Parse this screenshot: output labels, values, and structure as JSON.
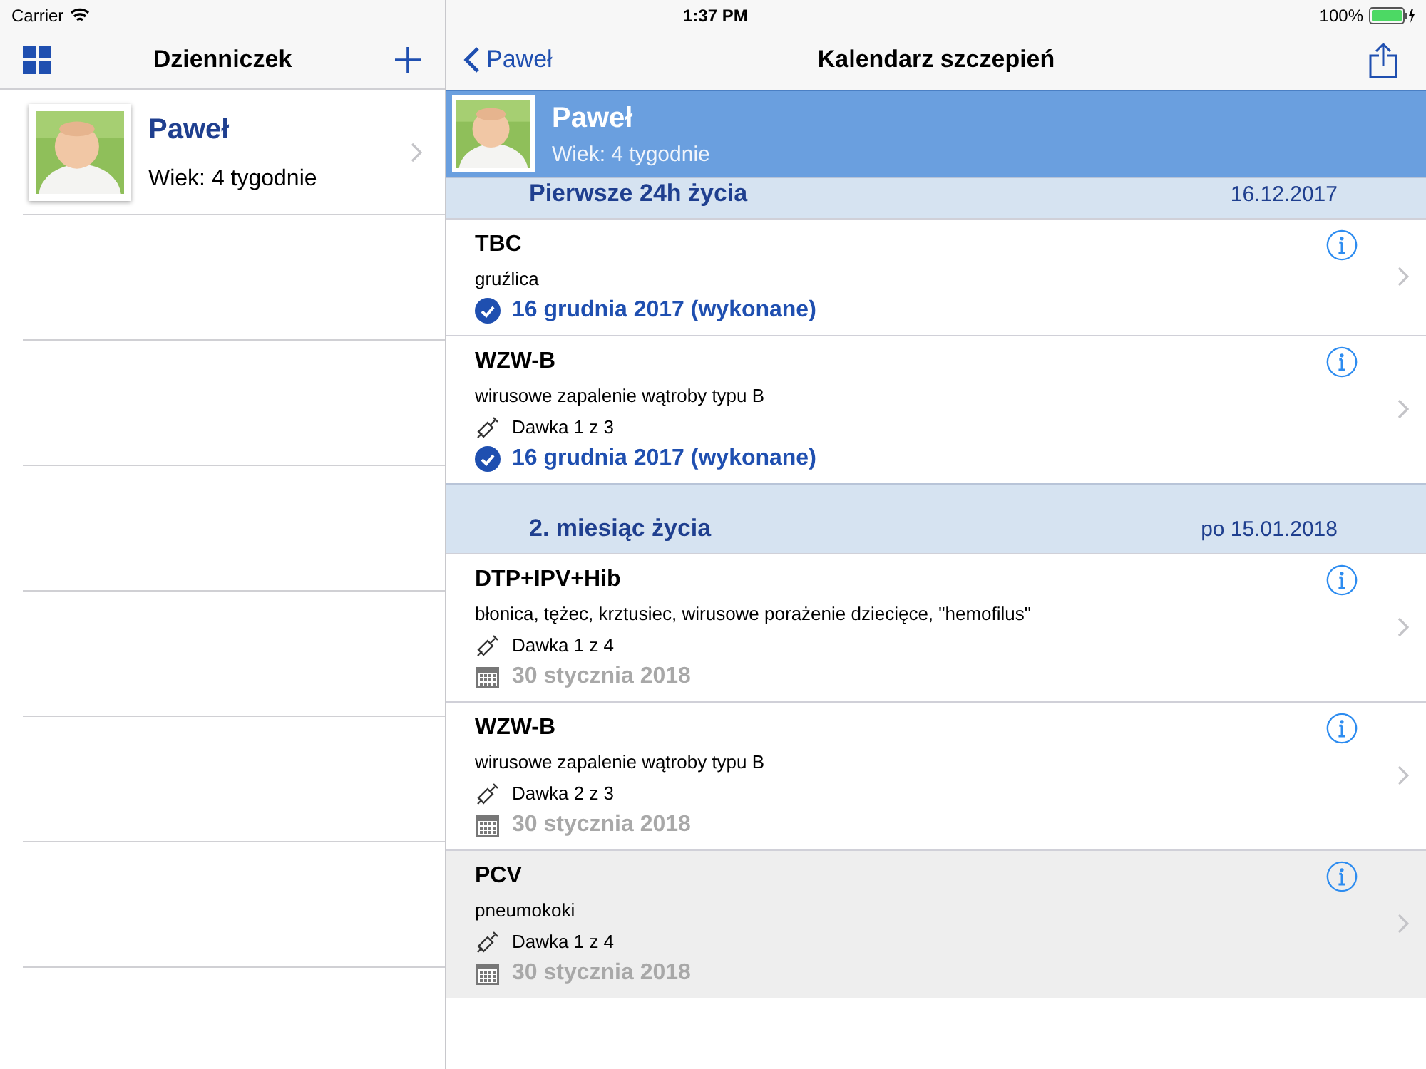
{
  "status_bar": {
    "carrier": "Carrier",
    "time": "1:37 PM",
    "battery": "100%"
  },
  "sidebar": {
    "title": "Dzienniczek",
    "children_list": [
      {
        "name": "Paweł",
        "age": "Wiek: 4 tygodnie",
        "selected": false
      }
    ]
  },
  "nav": {
    "back": "Paweł",
    "title": "Kalendarz szczepień"
  },
  "profile": {
    "name": "Paweł",
    "age": "Wiek: 4 tygodnie"
  },
  "sections": [
    {
      "title": "Pierwsze 24h życia",
      "date": "16.12.2017",
      "vaccines": [
        {
          "name": "TBC",
          "description": "gruźlica",
          "kind": "done",
          "date": "16 grudnia 2017 (wykonane)",
          "selected": false
        },
        {
          "name": "WZW-B",
          "description": "wirusowe zapalenie wątroby typu B",
          "dose": "Dawka 1 z 3",
          "kind": "done",
          "date": "16 grudnia 2017 (wykonane)",
          "selected": false
        }
      ]
    },
    {
      "title": "2. miesiąc życia",
      "date": "po 15.01.2018",
      "vaccines": [
        {
          "name": "DTP+IPV+Hib",
          "description": "błonica, tężec, krztusiec, wirusowe porażenie dziecięce, \"hemofilus\"",
          "dose": "Dawka 1 z 4",
          "kind": "planned",
          "date": "30 stycznia 2018",
          "selected": false
        },
        {
          "name": "WZW-B",
          "description": "wirusowe zapalenie wątroby typu B",
          "dose": "Dawka 2 z 3",
          "kind": "planned",
          "date": "30 stycznia 2018",
          "selected": false
        },
        {
          "name": "PCV",
          "description": "pneumokoki",
          "dose": "Dawka 1 z 4",
          "kind": "planned",
          "date": "30 stycznia 2018",
          "selected": true
        }
      ]
    }
  ]
}
